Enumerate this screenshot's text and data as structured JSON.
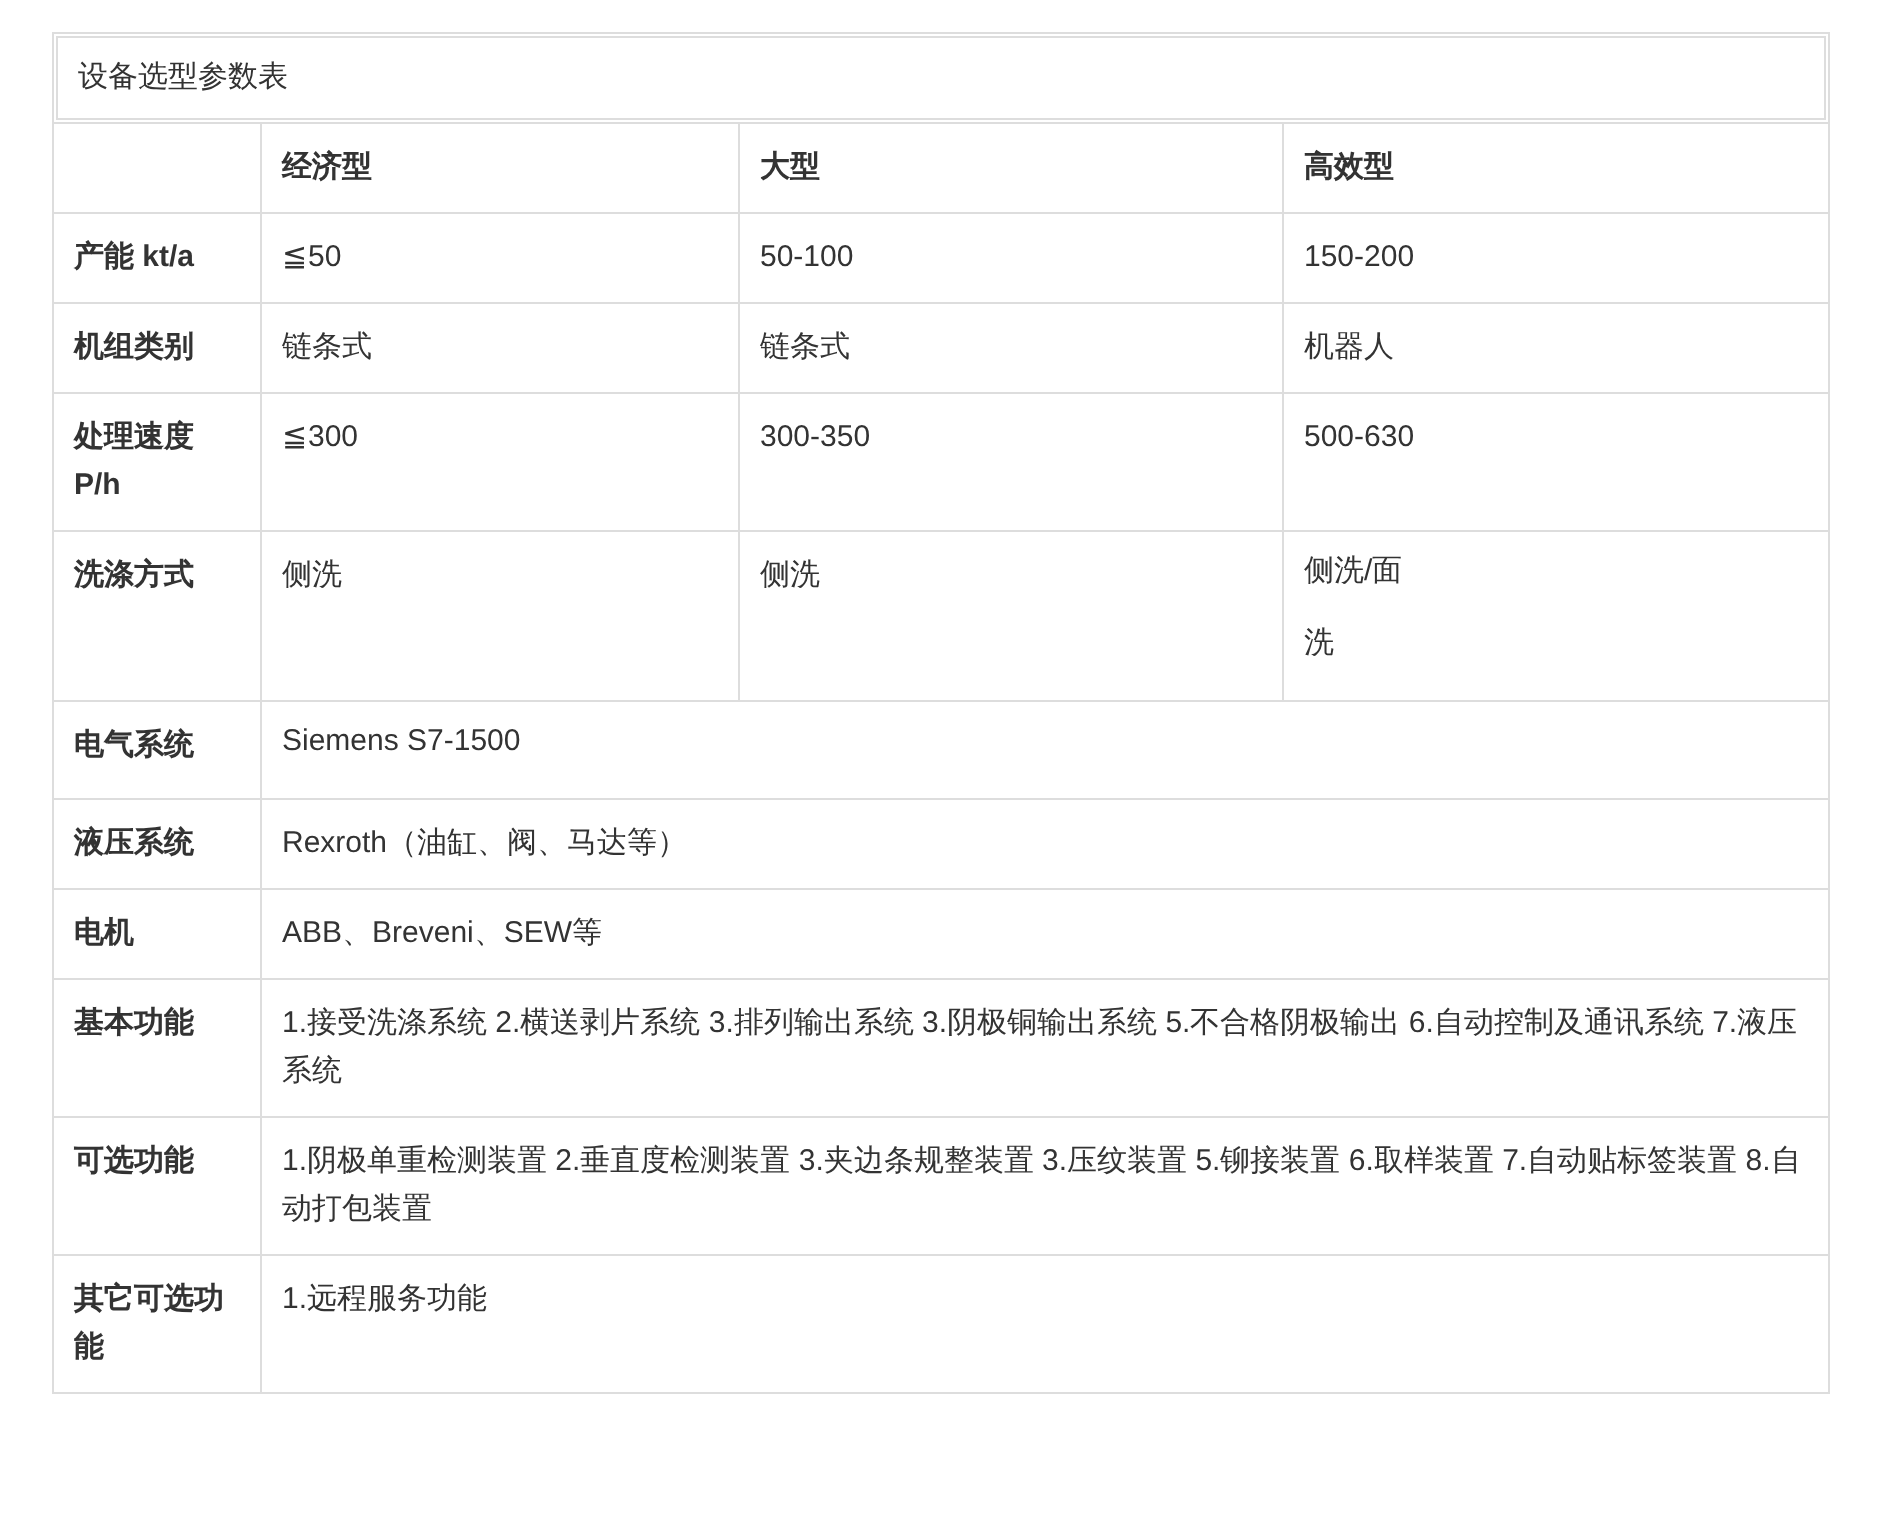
{
  "title": "设备选型参数表",
  "columns": [
    "经济型",
    "大型",
    "高效型"
  ],
  "rows": [
    {
      "label": "产能 kt/a",
      "cells": [
        {
          "text": "≦50"
        },
        {
          "text": "50-100"
        },
        {
          "text": "150-200"
        }
      ]
    },
    {
      "label": "机组类别",
      "cells": [
        {
          "text": "链条式"
        },
        {
          "text": "链条式"
        },
        {
          "text": "机器人"
        }
      ]
    },
    {
      "label": "处理速度P/h",
      "cells": [
        {
          "text": "≦300"
        },
        {
          "text": "300-350"
        },
        {
          "text": "500-630"
        }
      ]
    },
    {
      "label": "洗涤方式",
      "cells": [
        {
          "text": "侧洗"
        },
        {
          "text": "侧洗"
        },
        {
          "text": "侧洗/面洗",
          "kind": "narrow"
        }
      ]
    },
    {
      "label": "电气系统",
      "cells": [
        {
          "text": "Siemens S7-1500",
          "kind": "narrow"
        }
      ]
    },
    {
      "label": "液压系统",
      "cells": [
        {
          "text": "Rexroth（油缸、阀、马达等）"
        }
      ]
    },
    {
      "label": "电机",
      "cells": [
        {
          "text": "ABB、Breveni、SEW等"
        }
      ]
    },
    {
      "label": "基本功能",
      "cells": [
        {
          "text": "1.接受洗涤系统 2.横送剥片系统 3.排列输出系统 3.阴极铜输出系统 5.不合格阴极输出 6.自动控制及通讯系统 7.液压系统"
        }
      ]
    },
    {
      "label": "可选功能",
      "cells": [
        {
          "text": "1.阴极单重检测装置 2.垂直度检测装置 3.夹边条规整装置 3.压纹装置 5.铆接装置 6.取样装置 7.自动贴标签装置 8.自动打包装置"
        }
      ]
    },
    {
      "label": "其它可选功能",
      "cells": [
        {
          "text": "1.远程服务功能"
        }
      ]
    }
  ]
}
